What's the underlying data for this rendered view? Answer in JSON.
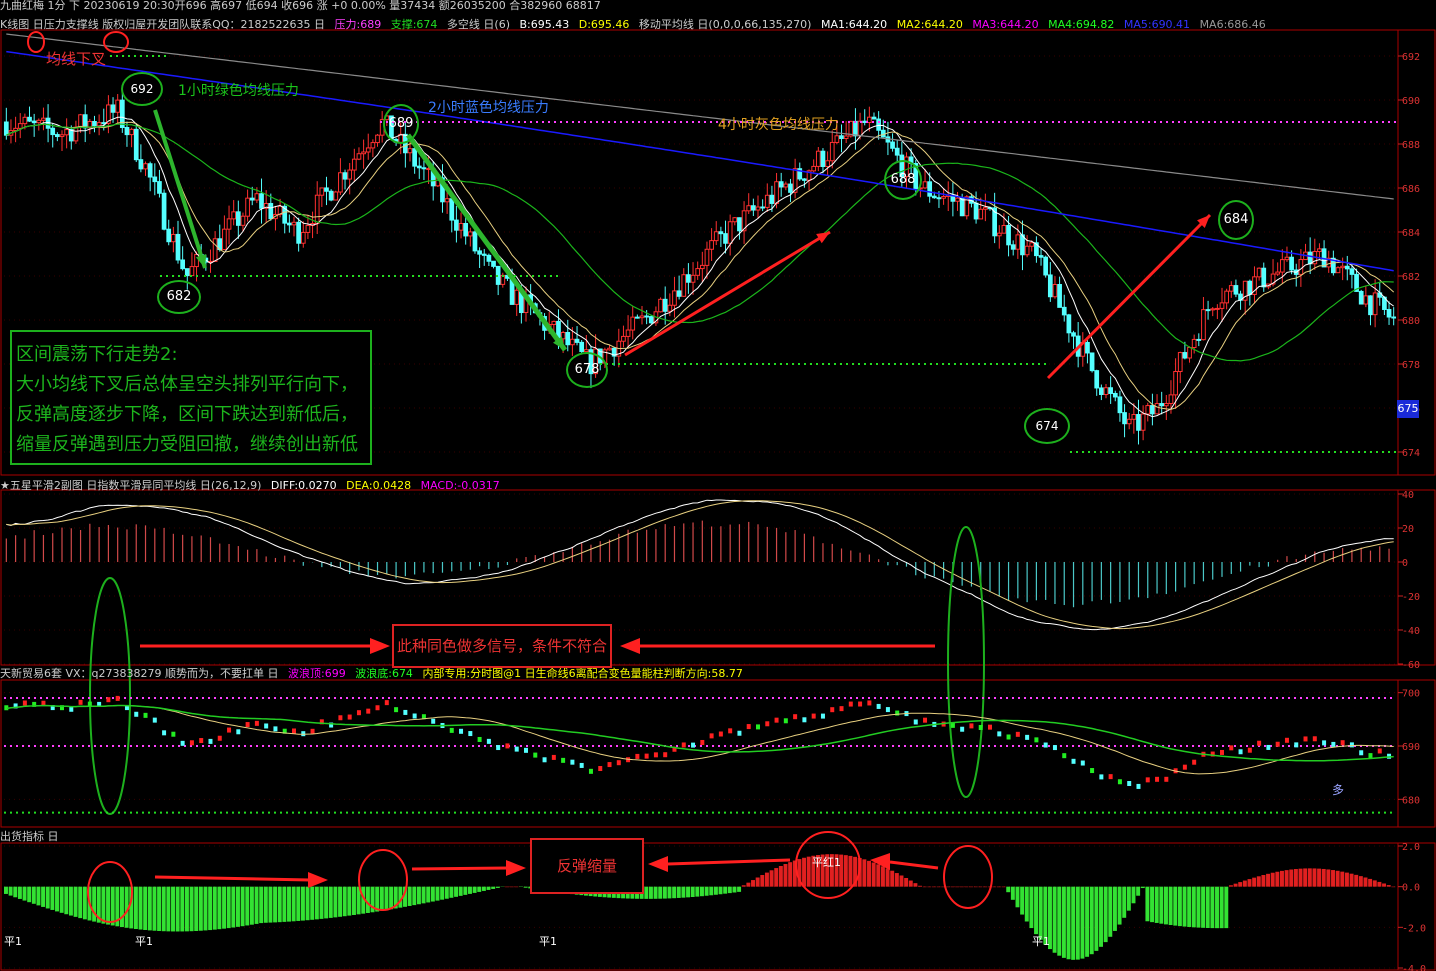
{
  "top_bar": {
    "text": "九曲红梅 1分  下  20230619 20:30开696 高697 低694 收696 涨 +0 0.00% 量37434 额26035200 合382960 68817"
  },
  "main_panel": {
    "title": "K线图 日压力支撑线 版权归屋开发团队联系QQ：2182522635 日",
    "pressure": "压力:689",
    "support": "支撑:674",
    "bull_bear": "多空线 日(6)",
    "b": "B:695.43",
    "d": "D:695.46",
    "ma_title": "移动平均线 日(0,0,0,66,135,270)",
    "ma1": "MA1:644.20",
    "ma2": "MA2:644.20",
    "ma3": "MA3:644.20",
    "ma4": "MA4:694.82",
    "ma5": "MA5:690.41",
    "ma6": "MA6:686.46",
    "y_ticks": [
      "692",
      "690",
      "688",
      "686",
      "684",
      "682",
      "680",
      "678",
      "676",
      "674"
    ],
    "last_price": "675",
    "label_ma_cross": "均线下叉",
    "label_1h": "1小时绿色均线压力",
    "label_2h": "2小时蓝色均线压力",
    "label_4h": "4小时灰色均线压力",
    "bubble_692": "692",
    "bubble_682": "682",
    "bubble_689": "689",
    "bubble_678": "678",
    "bubble_688": "688",
    "bubble_674": "674",
    "bubble_684": "684",
    "summary": [
      "区间震荡下行走势2:",
      "大小均线下叉后总体呈空头排列平行向下，",
      "反弹高度逐步下降，区间下跌达到新低后，",
      "缩量反弹遇到压力受阻回撤，继续创出新低"
    ]
  },
  "macd_panel": {
    "title": "★五星平滑2副图 日指数平滑异同平均线 日(26,12,9)",
    "diff": "DIFF:0.0270",
    "dea": "DEA:0.0428",
    "macd": "MACD:-0.0317",
    "y_ticks": [
      "40",
      "20",
      "0",
      "-20",
      "-40",
      "-60"
    ],
    "signal_note": "此种同色做多信号，条件不符合"
  },
  "trade_panel": {
    "title": "天新贸易6套 VX：q273838279  顺势而为，不要扛单 日",
    "top": "波浪顶:699",
    "bottom": "波浪底:674",
    "desc": "内部专用:分时图@1 日生命线6离配合变色量能柱判断方向:58.77",
    "y_ticks": [
      "700",
      "690",
      "680"
    ],
    "marker_duo": "多"
  },
  "volume_panel": {
    "title": "出货指标 日",
    "y_ticks": [
      "2.0",
      "0.0",
      "-2.0",
      "-4.0"
    ],
    "rebound_note": "反弹缩量",
    "flat_labels": [
      "平1",
      "平1",
      "平1",
      "平1"
    ],
    "peak_label": "平红1"
  },
  "chart_data": {
    "type": "line",
    "x_note": "1-minute bars, 20230619",
    "price_path": [
      [
        0,
        689
      ],
      [
        0.04,
        688.5
      ],
      [
        0.08,
        689.5
      ],
      [
        0.1,
        687
      ],
      [
        0.13,
        682
      ],
      [
        0.18,
        685.5
      ],
      [
        0.21,
        684
      ],
      [
        0.27,
        689
      ],
      [
        0.31,
        686
      ],
      [
        0.35,
        682
      ],
      [
        0.42,
        678
      ],
      [
        0.46,
        680
      ],
      [
        0.52,
        684
      ],
      [
        0.58,
        687
      ],
      [
        0.62,
        689
      ],
      [
        0.66,
        686
      ],
      [
        0.7,
        685
      ],
      [
        0.74,
        683
      ],
      [
        0.78,
        678
      ],
      [
        0.81,
        675
      ],
      [
        0.83,
        676
      ],
      [
        0.87,
        681
      ],
      [
        0.91,
        682
      ],
      [
        0.95,
        683
      ],
      [
        0.98,
        681
      ],
      [
        1.0,
        680
      ]
    ],
    "levels": {
      "resistance": 689,
      "support": 674,
      "level_682": 682,
      "level_678": 678,
      "level_692": 692
    },
    "ylim": [
      673,
      693
    ],
    "macd_ylim": [
      -60,
      40
    ],
    "trade_ylim": [
      675,
      702
    ],
    "volume_ylim": [
      -4,
      2
    ],
    "colors": {
      "up": "#ff3030",
      "down": "#54ffff",
      "ma_green": "#1bb51b",
      "ma_blue": "#1a1aff",
      "ma_gray": "#8a8a8a",
      "resistance": "#ff40ff",
      "support": "#22dd22"
    }
  }
}
